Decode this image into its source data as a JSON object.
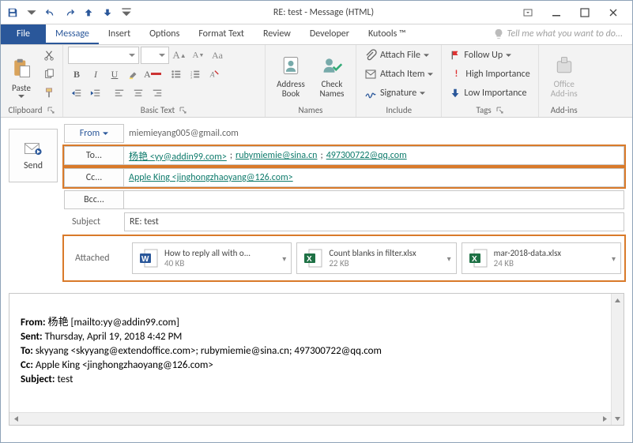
{
  "title": "RE: test - Message (HTML)",
  "tabs": {
    "file": "File",
    "message": "Message",
    "insert": "Insert",
    "options": "Options",
    "formatText": "Format Text",
    "review": "Review",
    "developer": "Developer",
    "kutools": "Kutools ™",
    "tell": "Tell me what you want to do..."
  },
  "ribbon": {
    "clipboard": {
      "label": "Clipboard",
      "paste": "Paste"
    },
    "basicText": {
      "label": "Basic Text"
    },
    "names": {
      "label": "Names",
      "addressBook": "Address\nBook",
      "checkNames": "Check\nNames"
    },
    "include": {
      "label": "Include",
      "attachFile": "Attach File",
      "attachItem": "Attach Item",
      "signature": "Signature"
    },
    "tags": {
      "label": "Tags",
      "followUp": "Follow Up",
      "highImportance": "High Importance",
      "lowImportance": "Low Importance"
    },
    "addins": {
      "label": "Add-ins",
      "office": "Office\nAdd-ins"
    }
  },
  "compose": {
    "send": "Send",
    "fromLabel": "From",
    "fromValue": "miemieyang005@gmail.com",
    "toLabel": "To...",
    "toValues": [
      "杨艳 <yy@addin99.com>",
      "rubymiemie@sina.cn",
      "497300722@qq.com"
    ],
    "ccLabel": "Cc...",
    "ccValues": [
      "Apple King <jinghongzhaoyang@126.com>"
    ],
    "bccLabel": "Bcc...",
    "subjectLabel": "Subject",
    "subjectValue": "RE: test",
    "attachedLabel": "Attached",
    "attachments": [
      {
        "name": "How to reply all with o...",
        "size": "40 KB",
        "type": "word"
      },
      {
        "name": "Count blanks in filter.xlsx",
        "size": "22 KB",
        "type": "excel"
      },
      {
        "name": "mar-2018-data.xlsx",
        "size": "24 KB",
        "type": "excel"
      }
    ]
  },
  "body": {
    "fromLabel": "From:",
    "fromValue": "杨艳 [mailto:yy@addin99.com]",
    "sentLabel": "Sent:",
    "sentValue": "Thursday, April 19, 2018 4:42 PM",
    "toLabel": "To:",
    "toValue": "skyyang <skyyang@extendoffice.com>; rubymiemie@sina.cn; 497300722@qq.com",
    "ccLabel": "Cc:",
    "ccValue": "Apple King <jinghongzhaoyang@126.com>",
    "subjectLabel": "Subject:",
    "subjectValue": "test"
  }
}
